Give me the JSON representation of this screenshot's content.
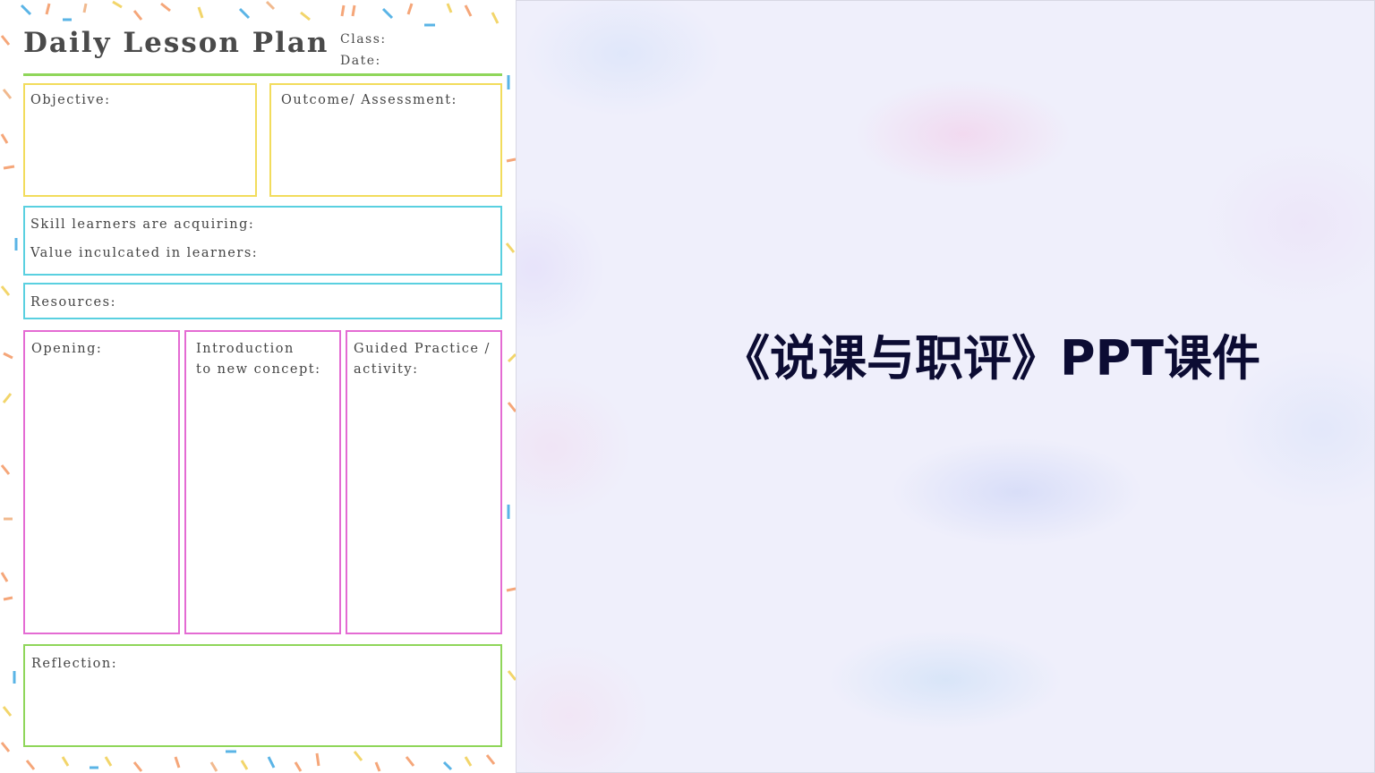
{
  "lesson_plan": {
    "title": "Daily Lesson Plan",
    "class_label": "Class:",
    "date_label": "Date:",
    "objective_label": "Objective:",
    "outcome_label": "Outcome/ Assessment:",
    "skill_label": "Skill learners are acquiring:",
    "value_label": "Value inculcated in learners:",
    "resources_label": "Resources:",
    "opening_label": "Opening:",
    "introduction_label": "Introduction\nto new concept:",
    "guided_label": "Guided Practice /\nactivity:",
    "reflection_label": "Reflection:",
    "colors": {
      "yellow": "#f2dc5c",
      "cyan": "#5ad0e0",
      "pink": "#e46bd3",
      "green": "#8fd65a",
      "confetti": [
        "#f5a679",
        "#5ab4e6",
        "#f2d56a",
        "#f1b98e"
      ]
    }
  },
  "slide": {
    "title": "《说课与职评》PPT课件",
    "background": "#efeffb",
    "title_color": "#0c0c33"
  }
}
